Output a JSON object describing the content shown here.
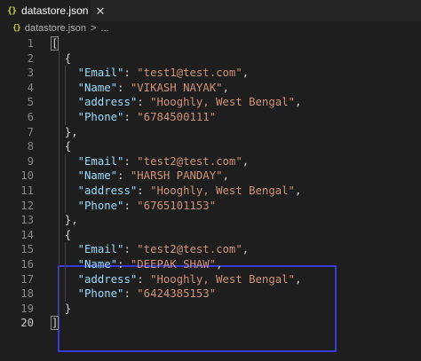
{
  "tab": {
    "label": "datastore.json",
    "icon": "{}"
  },
  "breadcrumb": {
    "file": "datastore.json",
    "separator": ">",
    "more": "..."
  },
  "colors": {
    "background": "#1e1e1e",
    "key": "#9cdcfe",
    "string": "#ce9178",
    "punctuation": "#d4d4d4",
    "line_number": "#858585",
    "highlight_border": "#3a3ad6"
  },
  "lines": [
    {
      "n": "1",
      "tokens": [
        [
          "punc",
          "["
        ]
      ]
    },
    {
      "n": "2",
      "tokens": [
        [
          "punc",
          "  {"
        ]
      ]
    },
    {
      "n": "3",
      "tokens": [
        [
          "punc",
          "    "
        ],
        [
          "key",
          "\"Email\""
        ],
        [
          "punc",
          ": "
        ],
        [
          "str",
          "\"test1@test.com\""
        ],
        [
          "punc",
          ","
        ]
      ]
    },
    {
      "n": "4",
      "tokens": [
        [
          "punc",
          "    "
        ],
        [
          "key",
          "\"Name\""
        ],
        [
          "punc",
          ": "
        ],
        [
          "str",
          "\"VIKASH NAYAK\""
        ],
        [
          "punc",
          ","
        ]
      ]
    },
    {
      "n": "5",
      "tokens": [
        [
          "punc",
          "    "
        ],
        [
          "key",
          "\"address\""
        ],
        [
          "punc",
          ": "
        ],
        [
          "str",
          "\"Hooghly, West Bengal\""
        ],
        [
          "punc",
          ","
        ]
      ]
    },
    {
      "n": "6",
      "tokens": [
        [
          "punc",
          "    "
        ],
        [
          "key",
          "\"Phone\""
        ],
        [
          "punc",
          ": "
        ],
        [
          "str",
          "\"6784500111\""
        ]
      ]
    },
    {
      "n": "7",
      "tokens": [
        [
          "punc",
          "  },"
        ]
      ]
    },
    {
      "n": "8",
      "tokens": [
        [
          "punc",
          "  {"
        ]
      ]
    },
    {
      "n": "9",
      "tokens": [
        [
          "punc",
          "    "
        ],
        [
          "key",
          "\"Email\""
        ],
        [
          "punc",
          ": "
        ],
        [
          "str",
          "\"test2@test.com\""
        ],
        [
          "punc",
          ","
        ]
      ]
    },
    {
      "n": "10",
      "tokens": [
        [
          "punc",
          "    "
        ],
        [
          "key",
          "\"Name\""
        ],
        [
          "punc",
          ": "
        ],
        [
          "str",
          "\"HARSH PANDAY\""
        ],
        [
          "punc",
          ","
        ]
      ]
    },
    {
      "n": "11",
      "tokens": [
        [
          "punc",
          "    "
        ],
        [
          "key",
          "\"address\""
        ],
        [
          "punc",
          ": "
        ],
        [
          "str",
          "\"Hooghly, West Bengal\""
        ],
        [
          "punc",
          ","
        ]
      ]
    },
    {
      "n": "12",
      "tokens": [
        [
          "punc",
          "    "
        ],
        [
          "key",
          "\"Phone\""
        ],
        [
          "punc",
          ": "
        ],
        [
          "str",
          "\"6765101153\""
        ]
      ]
    },
    {
      "n": "13",
      "tokens": [
        [
          "punc",
          "  },"
        ]
      ]
    },
    {
      "n": "14",
      "tokens": [
        [
          "punc",
          "  {"
        ]
      ]
    },
    {
      "n": "15",
      "tokens": [
        [
          "punc",
          "    "
        ],
        [
          "key",
          "\"Email\""
        ],
        [
          "punc",
          ": "
        ],
        [
          "str",
          "\"test2@test.com\""
        ],
        [
          "punc",
          ","
        ]
      ]
    },
    {
      "n": "16",
      "tokens": [
        [
          "punc",
          "    "
        ],
        [
          "key",
          "\"Name\""
        ],
        [
          "punc",
          ": "
        ],
        [
          "str",
          "\"DEEPAK SHAW\""
        ],
        [
          "punc",
          ","
        ]
      ]
    },
    {
      "n": "17",
      "tokens": [
        [
          "punc",
          "    "
        ],
        [
          "key",
          "\"address\""
        ],
        [
          "punc",
          ": "
        ],
        [
          "str",
          "\"Hooghly, West Bengal\""
        ],
        [
          "punc",
          ","
        ]
      ]
    },
    {
      "n": "18",
      "tokens": [
        [
          "punc",
          "    "
        ],
        [
          "key",
          "\"Phone\""
        ],
        [
          "punc",
          ": "
        ],
        [
          "str",
          "\"6424385153\""
        ]
      ]
    },
    {
      "n": "19",
      "tokens": [
        [
          "punc",
          "  }"
        ]
      ]
    },
    {
      "n": "20",
      "tokens": [
        [
          "punc",
          "]"
        ]
      ]
    }
  ]
}
